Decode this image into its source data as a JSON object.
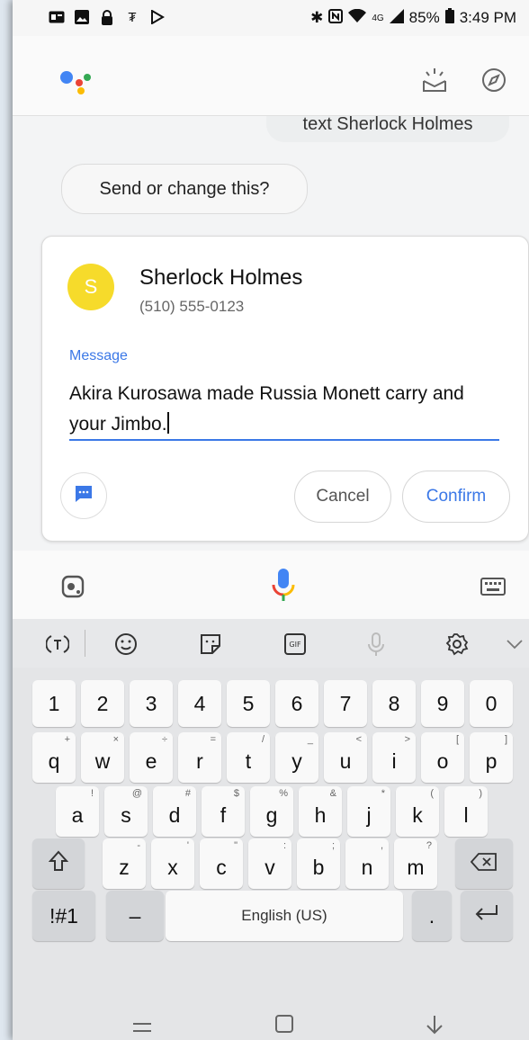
{
  "status_bar": {
    "left_icons": [
      "gallery-card-icon",
      "image-icon",
      "lock-icon",
      "trend-icon",
      "play-store-icon"
    ],
    "battery": "85%",
    "time": "3:49 PM"
  },
  "header": {
    "icons": [
      "assistant-logo",
      "updates-icon",
      "explore-icon"
    ]
  },
  "conversation": {
    "user_query": "text Sherlock Holmes",
    "assistant_reply": "Send or change this?"
  },
  "message_card": {
    "avatar_letter": "S",
    "contact_name": "Sherlock Holmes",
    "contact_phone": "(510) 555-0123",
    "message_label": "Message",
    "message_text": "Akira Kurosawa made Russia Monett carry and your Jimbo.",
    "cancel_label": "Cancel",
    "confirm_label": "Confirm",
    "accent_color": "#3b78e7",
    "avatar_color": "#f6db2b"
  },
  "keyboard": {
    "number_row": [
      "1",
      "2",
      "3",
      "4",
      "5",
      "6",
      "7",
      "8",
      "9",
      "0"
    ],
    "row1": [
      {
        "key": "q",
        "hint": "+"
      },
      {
        "key": "w",
        "hint": "×"
      },
      {
        "key": "e",
        "hint": "÷"
      },
      {
        "key": "r",
        "hint": "="
      },
      {
        "key": "t",
        "hint": "/"
      },
      {
        "key": "y",
        "hint": "_"
      },
      {
        "key": "u",
        "hint": "<"
      },
      {
        "key": "i",
        "hint": ">"
      },
      {
        "key": "o",
        "hint": "["
      },
      {
        "key": "p",
        "hint": "]"
      }
    ],
    "row2": [
      {
        "key": "a",
        "hint": "!"
      },
      {
        "key": "s",
        "hint": "@"
      },
      {
        "key": "d",
        "hint": "#"
      },
      {
        "key": "f",
        "hint": "$"
      },
      {
        "key": "g",
        "hint": "%"
      },
      {
        "key": "h",
        "hint": "&"
      },
      {
        "key": "j",
        "hint": "*"
      },
      {
        "key": "k",
        "hint": "("
      },
      {
        "key": "l",
        "hint": ")"
      }
    ],
    "row3": [
      {
        "key": "z",
        "hint": "-"
      },
      {
        "key": "x",
        "hint": "'"
      },
      {
        "key": "c",
        "hint": "\""
      },
      {
        "key": "v",
        "hint": ":"
      },
      {
        "key": "b",
        "hint": ";"
      },
      {
        "key": "n",
        "hint": ","
      },
      {
        "key": "m",
        "hint": "?"
      }
    ],
    "symbols_label": "!#1",
    "dash_label": "–",
    "space_label": "English (US)",
    "period_label": "."
  }
}
